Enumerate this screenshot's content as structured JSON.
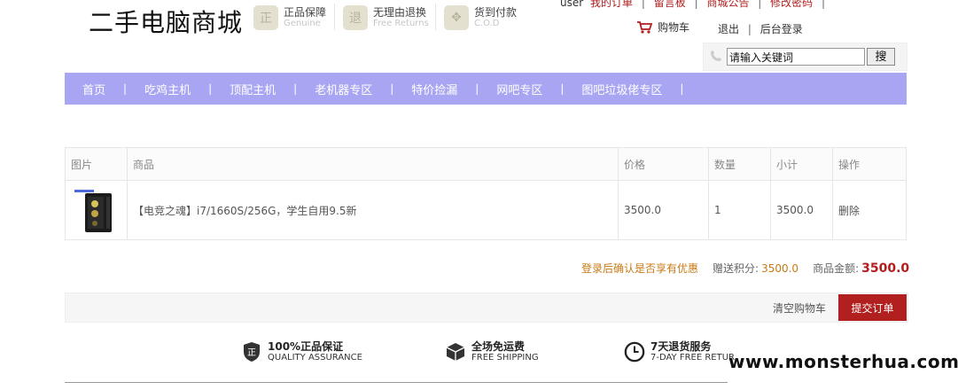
{
  "header": {
    "logo": "二手电脑商城",
    "badges": [
      {
        "icon": "genuine-icon",
        "glyph": "正",
        "title": "正品保障",
        "subtitle": "Genuine"
      },
      {
        "icon": "returns-icon",
        "glyph": "退",
        "title": "无理由退换",
        "subtitle": "Free Returns"
      },
      {
        "icon": "cod-icon",
        "glyph": "✥",
        "title": "货到付款",
        "subtitle": "C.O.D"
      }
    ],
    "top_links": {
      "user": "user",
      "my_orders": "我的订单",
      "message_board": "留言板",
      "announcement": "商城公告",
      "change_password": "修改密码"
    },
    "cart_label": "购物车",
    "logout": "退出",
    "admin_login": "后台登录",
    "search": {
      "value": "请输入关键词",
      "button": "搜"
    }
  },
  "nav": {
    "items": [
      "首页",
      "吃鸡主机",
      "顶配主机",
      "老机器专区",
      "特价捡漏",
      "网吧专区",
      "图吧垃圾佬专区"
    ]
  },
  "cart_table": {
    "headers": [
      "图片",
      "商品",
      "价格",
      "数量",
      "小计",
      "操作"
    ],
    "rows": [
      {
        "name": "【电竞之魂】i7/1660S/256G，学生自用9.5新",
        "price": "3500.0",
        "qty": "1",
        "subtotal": "3500.0",
        "action": "删除"
      }
    ]
  },
  "summary": {
    "login_hint": "登录后确认是否享有优惠",
    "points_label": "赠送积分:",
    "points_value": "3500.0",
    "total_label": "商品金额:",
    "total_value": "3500.0"
  },
  "actions": {
    "clear": "清空购物车",
    "submit": "提交订单"
  },
  "features": [
    {
      "icon": "shield-icon",
      "title": "100%正品保证",
      "subtitle": "QUALITY ASSURANCE"
    },
    {
      "icon": "box-icon",
      "title": "全场免运费",
      "subtitle": "FREE SHIPPING"
    },
    {
      "icon": "clock-icon",
      "title": "7天退货服务",
      "subtitle": "7-DAY FREE RETUR"
    }
  ],
  "watermark": "www.monsterhua.com",
  "colors": {
    "nav_bg": "#a8a6f2",
    "accent_red": "#b11f1f",
    "accent_orange": "#c87a16"
  }
}
